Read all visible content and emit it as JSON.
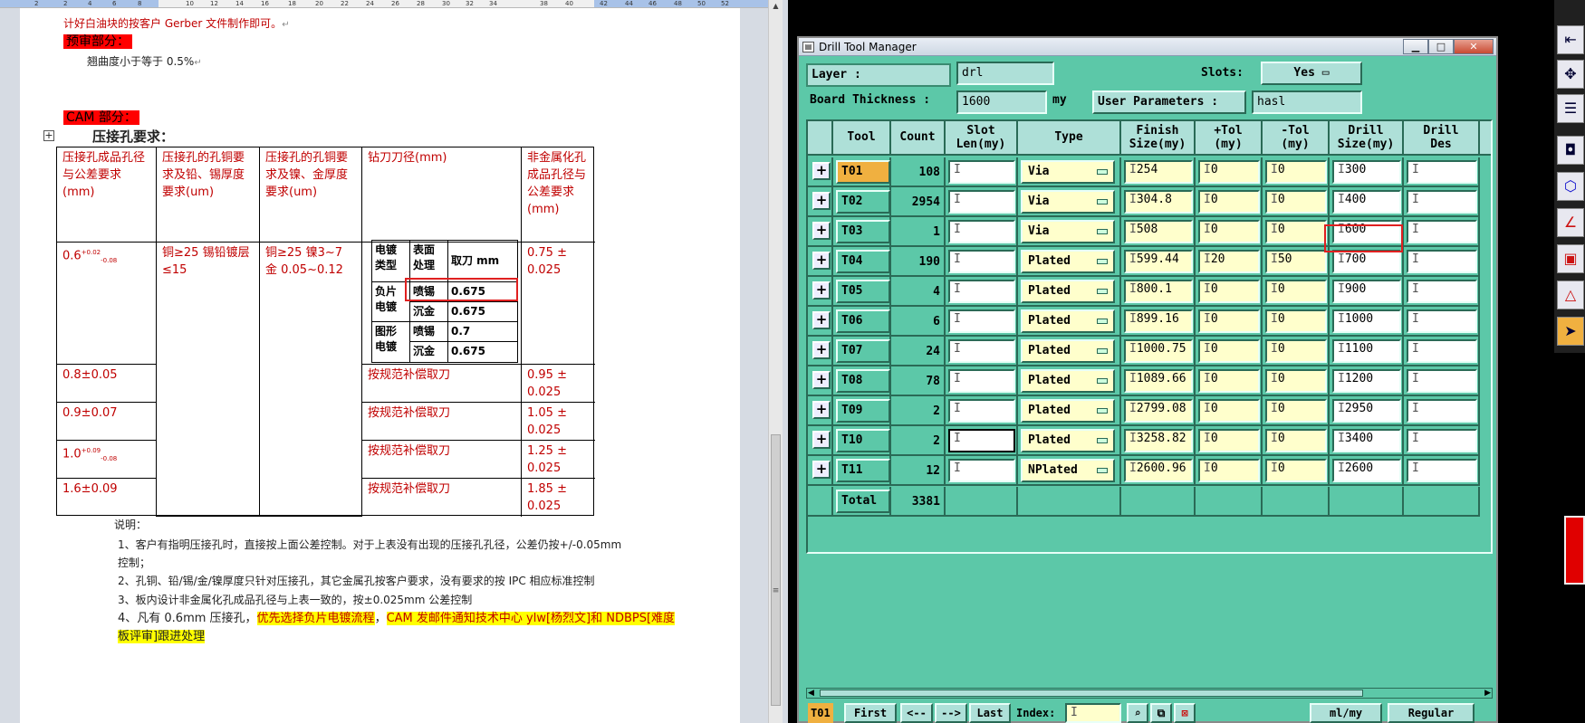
{
  "word": {
    "ruler_numbers": [
      "2",
      "2",
      "4",
      "6",
      "8",
      "10",
      "12",
      "14",
      "16",
      "18",
      "20",
      "22",
      "24",
      "26",
      "28",
      "30",
      "32",
      "34",
      "38",
      "40",
      "42",
      "44",
      "46",
      "48",
      "50",
      "52"
    ],
    "line1": "计好白油块的按客户 Gerber 文件制作即可。",
    "section_prereview": "预审部分：",
    "warp_line": "翘曲度小于等于 0.5%",
    "section_cam": "CAM 部分：",
    "press_fit_title": "压接孔要求：",
    "table": {
      "headers": [
        "压接孔成品孔径与公差要求(mm)",
        "压接孔的孔铜要求及铅、锡厚度要求(um)",
        "压接孔的孔铜要求及镍、金厚度要求(um)",
        "钻刀刀径(mm)",
        "非金属化孔成品孔径与公差要求(mm)"
      ],
      "row1": {
        "hole": "0.6",
        "hole_sup": "+0.02",
        "hole_sub": "-0.08",
        "cu_pb": "铜≥25 锡铅镀层≤15",
        "cu_ni": "铜≥25 镍3~7 金 0.05~0.12",
        "npth": "0.75 ± 0.025"
      },
      "inner": {
        "h1": "电镀类型",
        "h2": "表面处理",
        "h3": "取刀 mm",
        "r1": "负片电镀",
        "r2": "图形电镀",
        "s1": "喷锡",
        "s2": "沉金",
        "s3": "喷锡",
        "s4": "沉金",
        "v1": "0.675",
        "v2": "0.675",
        "v3": "0.7",
        "v4": "0.675"
      },
      "rows": [
        {
          "hole": "0.8±0.05",
          "drill": "按规范补偿取刀",
          "npth": "0.95 ± 0.025"
        },
        {
          "hole": "0.9±0.07",
          "drill": "按规范补偿取刀",
          "npth": "1.05 ± 0.025"
        },
        {
          "hole": "1.0",
          "hole_sup": "+0.09",
          "hole_sub": "-0.08",
          "drill": "按规范补偿取刀",
          "npth": "1.25 ± 0.025"
        },
        {
          "hole": "1.6±0.09",
          "drill": "按规范补偿取刀",
          "npth": "1.85 ± 0.025"
        }
      ]
    },
    "notes_title": "说明：",
    "note1a": "1、客户有指明压接孔时，直接按上面公差控制。对于上表没有出现的压接孔孔径，公差仍按+/-0.05mm",
    "note1b": "控制；",
    "note2": "2、孔铜、铅/锡/金/镍厚度只针对压接孔，其它金属孔按客户要求，没有要求的按 IPC 相应标准控制",
    "note3": "3、板内设计非金属化孔成品孔径与上表一致的，按±0.025mm 公差控制",
    "note4_pre": "4、凡有 0.6mm 压接孔，",
    "note4_hl1": "优先选择负片电镀流程",
    "note4_comma": "，",
    "note4_hl2": "CAM 发邮件通知技术中心 ylw[杨烈文]和 NDBPS[难度",
    "note4_hl3": "板评审]跟进处理",
    "para_mark": "↵"
  },
  "drill": {
    "title": "Drill Tool Manager",
    "layer_label": "Layer        :",
    "layer_value": "drl",
    "slots_label": "Slots:",
    "slots_value": "Yes",
    "thickness_label": "Board Thickness :",
    "thickness_value": "1600",
    "thickness_unit": "my",
    "user_params_label": "User Parameters :",
    "user_params_value": "hasl",
    "columns": [
      {
        "l1": "Tool",
        "l2": ""
      },
      {
        "l1": "Count",
        "l2": ""
      },
      {
        "l1": "Slot",
        "l2": "Len(my)"
      },
      {
        "l1": "Type",
        "l2": ""
      },
      {
        "l1": "Finish",
        "l2": "Size(my)"
      },
      {
        "l1": "+Tol",
        "l2": "(my)"
      },
      {
        "l1": "-Tol",
        "l2": "(my)"
      },
      {
        "l1": "Drill",
        "l2": "Size(my)"
      },
      {
        "l1": "Drill",
        "l2": "Des"
      }
    ],
    "tools": [
      {
        "name": "T01",
        "count": "108",
        "type": "Via",
        "finish": "254",
        "ptol": "0",
        "ntol": "0",
        "drill": "300"
      },
      {
        "name": "T02",
        "count": "2954",
        "type": "Via",
        "finish": "304.8",
        "ptol": "0",
        "ntol": "0",
        "drill": "400"
      },
      {
        "name": "T03",
        "count": "1",
        "type": "Via",
        "finish": "508",
        "ptol": "0",
        "ntol": "0",
        "drill": "600"
      },
      {
        "name": "T04",
        "count": "190",
        "type": "Plated",
        "finish": "599.44",
        "ptol": "20",
        "ntol": "50",
        "drill": "700"
      },
      {
        "name": "T05",
        "count": "4",
        "type": "Plated",
        "finish": "800.1",
        "ptol": "0",
        "ntol": "0",
        "drill": "900"
      },
      {
        "name": "T06",
        "count": "6",
        "type": "Plated",
        "finish": "899.16",
        "ptol": "0",
        "ntol": "0",
        "drill": "1000"
      },
      {
        "name": "T07",
        "count": "24",
        "type": "Plated",
        "finish": "1000.75",
        "ptol": "0",
        "ntol": "0",
        "drill": "1100"
      },
      {
        "name": "T08",
        "count": "78",
        "type": "Plated",
        "finish": "1089.66",
        "ptol": "0",
        "ntol": "0",
        "drill": "1200"
      },
      {
        "name": "T09",
        "count": "2",
        "type": "Plated",
        "finish": "2799.08",
        "ptol": "0",
        "ntol": "0",
        "drill": "2950"
      },
      {
        "name": "T10",
        "count": "2",
        "type": "Plated",
        "finish": "3258.82",
        "ptol": "0",
        "ntol": "0",
        "drill": "3400"
      },
      {
        "name": "T11",
        "count": "12",
        "type": "NPlated",
        "finish": "2600.96",
        "ptol": "0",
        "ntol": "0",
        "drill": "2600"
      }
    ],
    "total_label": "Total",
    "total_value": "3381",
    "footer": {
      "current_tool": "T01",
      "first": "First",
      "prev": "<--",
      "next": "-->",
      "last": "Last",
      "index_label": "Index:",
      "units": "ml/my",
      "mode": "Regular"
    }
  }
}
